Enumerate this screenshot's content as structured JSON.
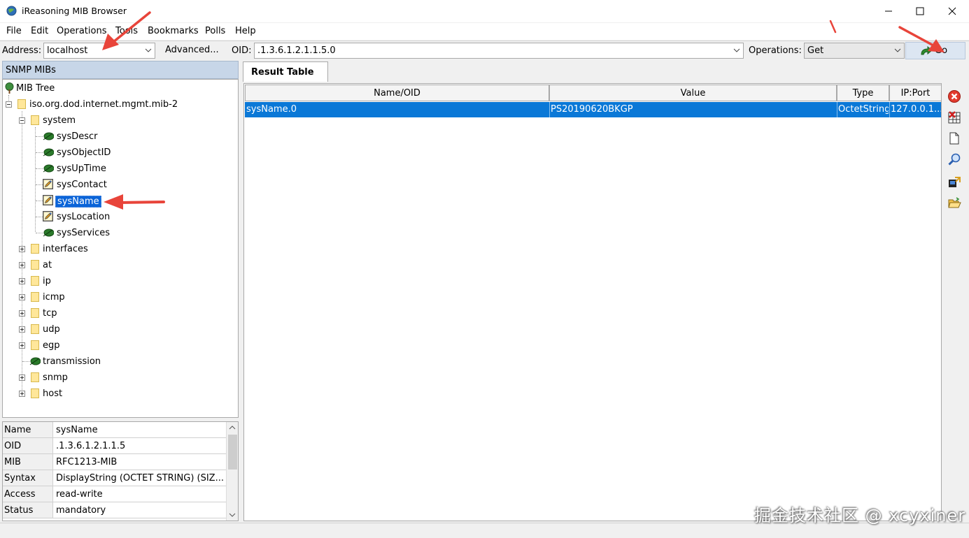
{
  "window": {
    "title": "iReasoning MIB Browser"
  },
  "menu": [
    "File",
    "Edit",
    "Operations",
    "Tools",
    "Bookmarks",
    "Polls",
    "Help"
  ],
  "toolbar": {
    "address_label": "Address:",
    "address_value": "localhost",
    "advanced_label": "Advanced...",
    "oid_label": "OID:",
    "oid_value": ".1.3.6.1.2.1.1.5.0",
    "operations_label": "Operations:",
    "operations_value": "Get",
    "go_label": "Go"
  },
  "left_panel": {
    "header": "SNMP MIBs",
    "tree": {
      "root": "MIB Tree",
      "mib2": "iso.org.dod.internet.mgmt.mib-2",
      "system": "system",
      "system_children": [
        "sysDescr",
        "sysObjectID",
        "sysUpTime",
        "sysContact",
        "sysName",
        "sysLocation",
        "sysServices"
      ],
      "groups": [
        "interfaces",
        "at",
        "ip",
        "icmp",
        "tcp",
        "udp",
        "egp",
        "transmission",
        "snmp",
        "host"
      ],
      "selected": "sysName"
    }
  },
  "properties": [
    {
      "key": "Name",
      "value": "sysName"
    },
    {
      "key": "OID",
      "value": ".1.3.6.1.2.1.1.5"
    },
    {
      "key": "MIB",
      "value": "RFC1213-MIB"
    },
    {
      "key": "Syntax",
      "value": "DisplayString (OCTET STRING) (SIZ..."
    },
    {
      "key": "Access",
      "value": "read-write"
    },
    {
      "key": "Status",
      "value": "mandatory"
    }
  ],
  "result": {
    "tab": "Result Table",
    "columns": [
      "Name/OID",
      "Value",
      "Type",
      "IP:Port"
    ],
    "rows": [
      {
        "name": "sysName.0",
        "value": "PS20190620BKGP",
        "type": "OctetString",
        "ipport": "127.0.0.1..."
      }
    ]
  },
  "watermark": "掘金技术社区 @ xcyxiner",
  "colors": {
    "selection": "#0a78d7",
    "header_bg": "#c7d6e8",
    "annotation_arrow": "#e8443a"
  }
}
